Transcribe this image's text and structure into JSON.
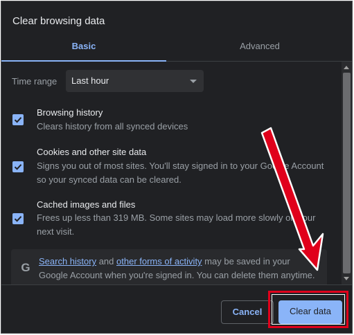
{
  "dialog": {
    "title": "Clear browsing data",
    "tabs": [
      {
        "label": "Basic",
        "active": true
      },
      {
        "label": "Advanced",
        "active": false
      }
    ]
  },
  "time_range": {
    "label": "Time range",
    "value": "Last hour"
  },
  "items": [
    {
      "title": "Browsing history",
      "description": "Clears history from all synced devices",
      "checked": true
    },
    {
      "title": "Cookies and other site data",
      "description": "Signs you out of most sites. You'll stay signed in to your Google Account so your synced data can be cleared.",
      "checked": true
    },
    {
      "title": "Cached images and files",
      "description": "Frees up less than 319 MB. Some sites may load more slowly on your next visit.",
      "checked": true
    }
  ],
  "info": {
    "link1": "Search history",
    "text1": " and ",
    "link2": "other forms of activity",
    "text2": " may be saved in your Google Account when you're signed in. You can delete them anytime."
  },
  "buttons": {
    "cancel": "Cancel",
    "clear": "Clear data"
  },
  "colors": {
    "accent": "#8ab4f8",
    "background": "#202124",
    "annotation": "#e0001b"
  },
  "icons": {
    "checkbox": "checkmark-icon",
    "google": "google-g-icon",
    "dropdown": "chevron-down-icon"
  }
}
